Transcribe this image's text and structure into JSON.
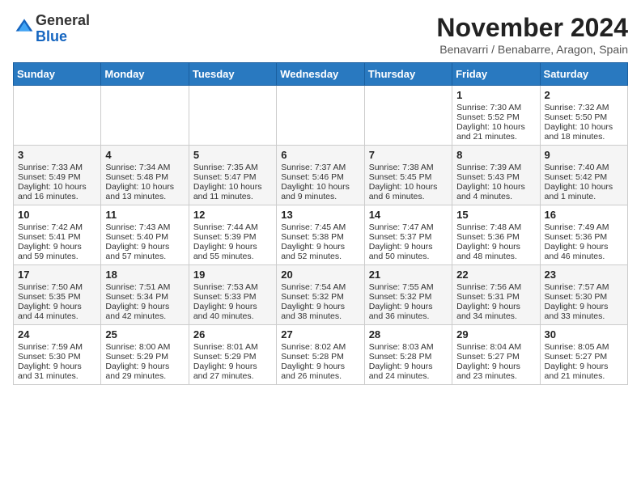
{
  "header": {
    "logo_general": "General",
    "logo_blue": "Blue",
    "month_title": "November 2024",
    "location": "Benavarri / Benabarre, Aragon, Spain"
  },
  "weekdays": [
    "Sunday",
    "Monday",
    "Tuesday",
    "Wednesday",
    "Thursday",
    "Friday",
    "Saturday"
  ],
  "weeks": [
    [
      {
        "day": "",
        "info": ""
      },
      {
        "day": "",
        "info": ""
      },
      {
        "day": "",
        "info": ""
      },
      {
        "day": "",
        "info": ""
      },
      {
        "day": "",
        "info": ""
      },
      {
        "day": "1",
        "info": "Sunrise: 7:30 AM\nSunset: 5:52 PM\nDaylight: 10 hours and 21 minutes."
      },
      {
        "day": "2",
        "info": "Sunrise: 7:32 AM\nSunset: 5:50 PM\nDaylight: 10 hours and 18 minutes."
      }
    ],
    [
      {
        "day": "3",
        "info": "Sunrise: 7:33 AM\nSunset: 5:49 PM\nDaylight: 10 hours and 16 minutes."
      },
      {
        "day": "4",
        "info": "Sunrise: 7:34 AM\nSunset: 5:48 PM\nDaylight: 10 hours and 13 minutes."
      },
      {
        "day": "5",
        "info": "Sunrise: 7:35 AM\nSunset: 5:47 PM\nDaylight: 10 hours and 11 minutes."
      },
      {
        "day": "6",
        "info": "Sunrise: 7:37 AM\nSunset: 5:46 PM\nDaylight: 10 hours and 9 minutes."
      },
      {
        "day": "7",
        "info": "Sunrise: 7:38 AM\nSunset: 5:45 PM\nDaylight: 10 hours and 6 minutes."
      },
      {
        "day": "8",
        "info": "Sunrise: 7:39 AM\nSunset: 5:43 PM\nDaylight: 10 hours and 4 minutes."
      },
      {
        "day": "9",
        "info": "Sunrise: 7:40 AM\nSunset: 5:42 PM\nDaylight: 10 hours and 1 minute."
      }
    ],
    [
      {
        "day": "10",
        "info": "Sunrise: 7:42 AM\nSunset: 5:41 PM\nDaylight: 9 hours and 59 minutes."
      },
      {
        "day": "11",
        "info": "Sunrise: 7:43 AM\nSunset: 5:40 PM\nDaylight: 9 hours and 57 minutes."
      },
      {
        "day": "12",
        "info": "Sunrise: 7:44 AM\nSunset: 5:39 PM\nDaylight: 9 hours and 55 minutes."
      },
      {
        "day": "13",
        "info": "Sunrise: 7:45 AM\nSunset: 5:38 PM\nDaylight: 9 hours and 52 minutes."
      },
      {
        "day": "14",
        "info": "Sunrise: 7:47 AM\nSunset: 5:37 PM\nDaylight: 9 hours and 50 minutes."
      },
      {
        "day": "15",
        "info": "Sunrise: 7:48 AM\nSunset: 5:36 PM\nDaylight: 9 hours and 48 minutes."
      },
      {
        "day": "16",
        "info": "Sunrise: 7:49 AM\nSunset: 5:36 PM\nDaylight: 9 hours and 46 minutes."
      }
    ],
    [
      {
        "day": "17",
        "info": "Sunrise: 7:50 AM\nSunset: 5:35 PM\nDaylight: 9 hours and 44 minutes."
      },
      {
        "day": "18",
        "info": "Sunrise: 7:51 AM\nSunset: 5:34 PM\nDaylight: 9 hours and 42 minutes."
      },
      {
        "day": "19",
        "info": "Sunrise: 7:53 AM\nSunset: 5:33 PM\nDaylight: 9 hours and 40 minutes."
      },
      {
        "day": "20",
        "info": "Sunrise: 7:54 AM\nSunset: 5:32 PM\nDaylight: 9 hours and 38 minutes."
      },
      {
        "day": "21",
        "info": "Sunrise: 7:55 AM\nSunset: 5:32 PM\nDaylight: 9 hours and 36 minutes."
      },
      {
        "day": "22",
        "info": "Sunrise: 7:56 AM\nSunset: 5:31 PM\nDaylight: 9 hours and 34 minutes."
      },
      {
        "day": "23",
        "info": "Sunrise: 7:57 AM\nSunset: 5:30 PM\nDaylight: 9 hours and 33 minutes."
      }
    ],
    [
      {
        "day": "24",
        "info": "Sunrise: 7:59 AM\nSunset: 5:30 PM\nDaylight: 9 hours and 31 minutes."
      },
      {
        "day": "25",
        "info": "Sunrise: 8:00 AM\nSunset: 5:29 PM\nDaylight: 9 hours and 29 minutes."
      },
      {
        "day": "26",
        "info": "Sunrise: 8:01 AM\nSunset: 5:29 PM\nDaylight: 9 hours and 27 minutes."
      },
      {
        "day": "27",
        "info": "Sunrise: 8:02 AM\nSunset: 5:28 PM\nDaylight: 9 hours and 26 minutes."
      },
      {
        "day": "28",
        "info": "Sunrise: 8:03 AM\nSunset: 5:28 PM\nDaylight: 9 hours and 24 minutes."
      },
      {
        "day": "29",
        "info": "Sunrise: 8:04 AM\nSunset: 5:27 PM\nDaylight: 9 hours and 23 minutes."
      },
      {
        "day": "30",
        "info": "Sunrise: 8:05 AM\nSunset: 5:27 PM\nDaylight: 9 hours and 21 minutes."
      }
    ]
  ]
}
